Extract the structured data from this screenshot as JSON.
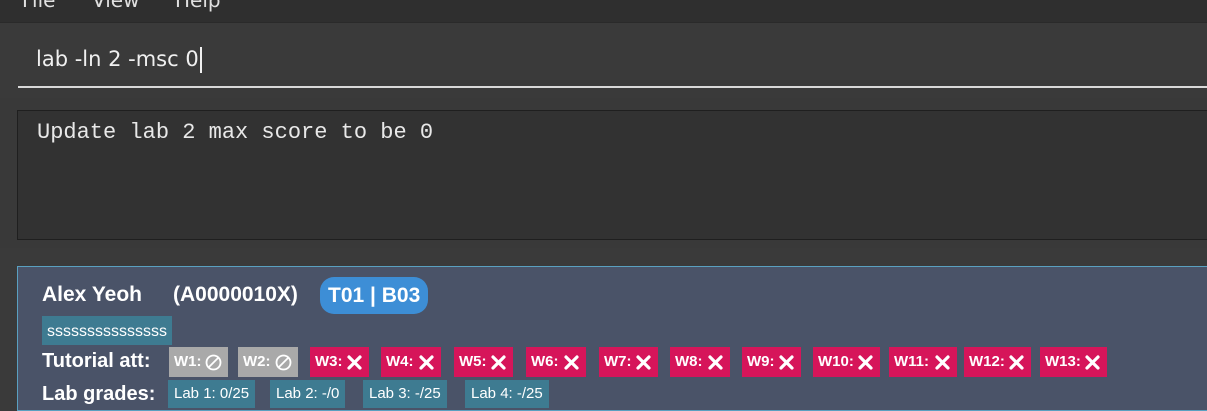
{
  "menu": {
    "file": "File",
    "view": "View",
    "help": "Help"
  },
  "command": {
    "value": "lab -ln 2 -msc 0"
  },
  "result": {
    "text": "Update lab 2 max score to be 0"
  },
  "student": {
    "name": "Alex Yeoh",
    "id": "(A0000010X)",
    "group": "T01 | B03",
    "tag": "sssssssssssssss",
    "tutorial_label": "Tutorial att:",
    "lab_label": "Lab grades:",
    "attendance": [
      {
        "week": "W1:",
        "status": "no-tutorial",
        "color": "#a9a9a9"
      },
      {
        "week": "W2:",
        "status": "no-tutorial",
        "color": "#a9a9a9"
      },
      {
        "week": "W3:",
        "status": "absent",
        "color": "#d6155a"
      },
      {
        "week": "W4:",
        "status": "absent",
        "color": "#d6155a"
      },
      {
        "week": "W5:",
        "status": "absent",
        "color": "#d6155a"
      },
      {
        "week": "W6:",
        "status": "absent",
        "color": "#d6155a"
      },
      {
        "week": "W7:",
        "status": "absent",
        "color": "#d6155a"
      },
      {
        "week": "W8:",
        "status": "absent",
        "color": "#d6155a"
      },
      {
        "week": "W9:",
        "status": "absent",
        "color": "#d6155a"
      },
      {
        "week": "W10:",
        "status": "absent",
        "color": "#d6155a"
      },
      {
        "week": "W11:",
        "status": "absent",
        "color": "#d6155a"
      },
      {
        "week": "W12:",
        "status": "absent",
        "color": "#d6155a"
      },
      {
        "week": "W13:",
        "status": "absent",
        "color": "#d6155a"
      }
    ],
    "labs": [
      "Lab 1: 0/25",
      "Lab 2: -/0",
      "Lab 3: -/25",
      "Lab 4: -/25"
    ]
  },
  "colors": {
    "background": "#3a3a3a",
    "card": "#4a5368",
    "group_badge": "#3d8ed6",
    "tag": "#3e7b91",
    "absent": "#d6155a",
    "no_tutorial": "#a9a9a9"
  }
}
